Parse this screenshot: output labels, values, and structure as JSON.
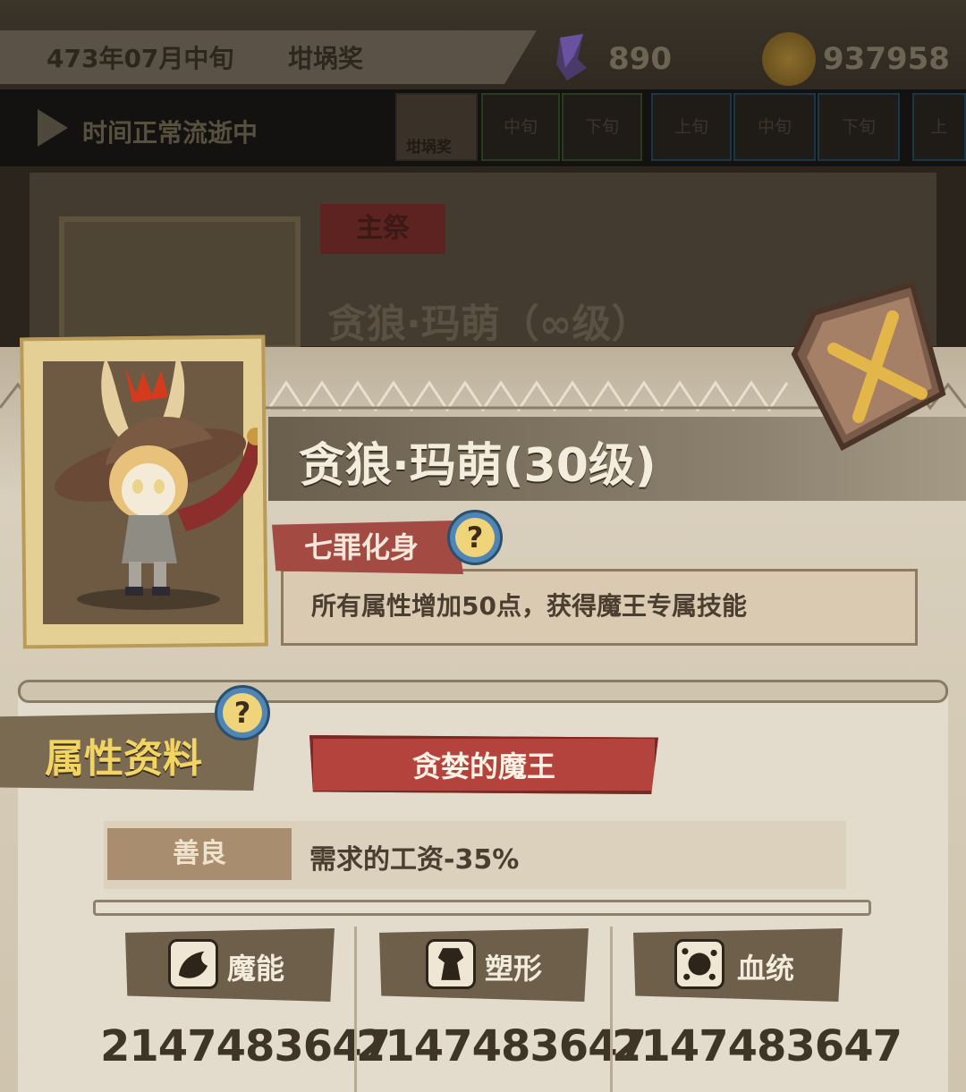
{
  "top": {
    "date": "473年07月中旬",
    "prize": "坩埚奖",
    "crystal_count": "890",
    "gold_count": "937958"
  },
  "timebar": {
    "status": "时间正常流逝中",
    "event_label": "坩埚奖",
    "slots": [
      "中旬",
      "下旬",
      "上旬",
      "中旬",
      "下旬",
      "上"
    ]
  },
  "background_card": {
    "main_tag": "主祭",
    "name": "贪狼·玛萌（∞级）"
  },
  "character": {
    "name": "贪狼·玛萌(30级)",
    "trait_tag": "七罪化身",
    "trait_desc": "所有属性增加50点，获得魔王专属技能"
  },
  "info": {
    "section_label": "属性资料",
    "title": "贪婪的魔王",
    "alignment": "善良",
    "wage_effect": "需求的工资-35%",
    "stats": [
      {
        "label": "魔能",
        "icon": "magic-energy-icon",
        "value": "2147483647"
      },
      {
        "label": "塑形",
        "icon": "body-shape-icon",
        "value": "2147483647"
      },
      {
        "label": "血统",
        "icon": "bloodline-icon",
        "value": "2147483647"
      }
    ]
  },
  "colors": {
    "accent_red": "#b5433d",
    "gold_text": "#f2d463",
    "help_blue": "#4f86b6"
  }
}
